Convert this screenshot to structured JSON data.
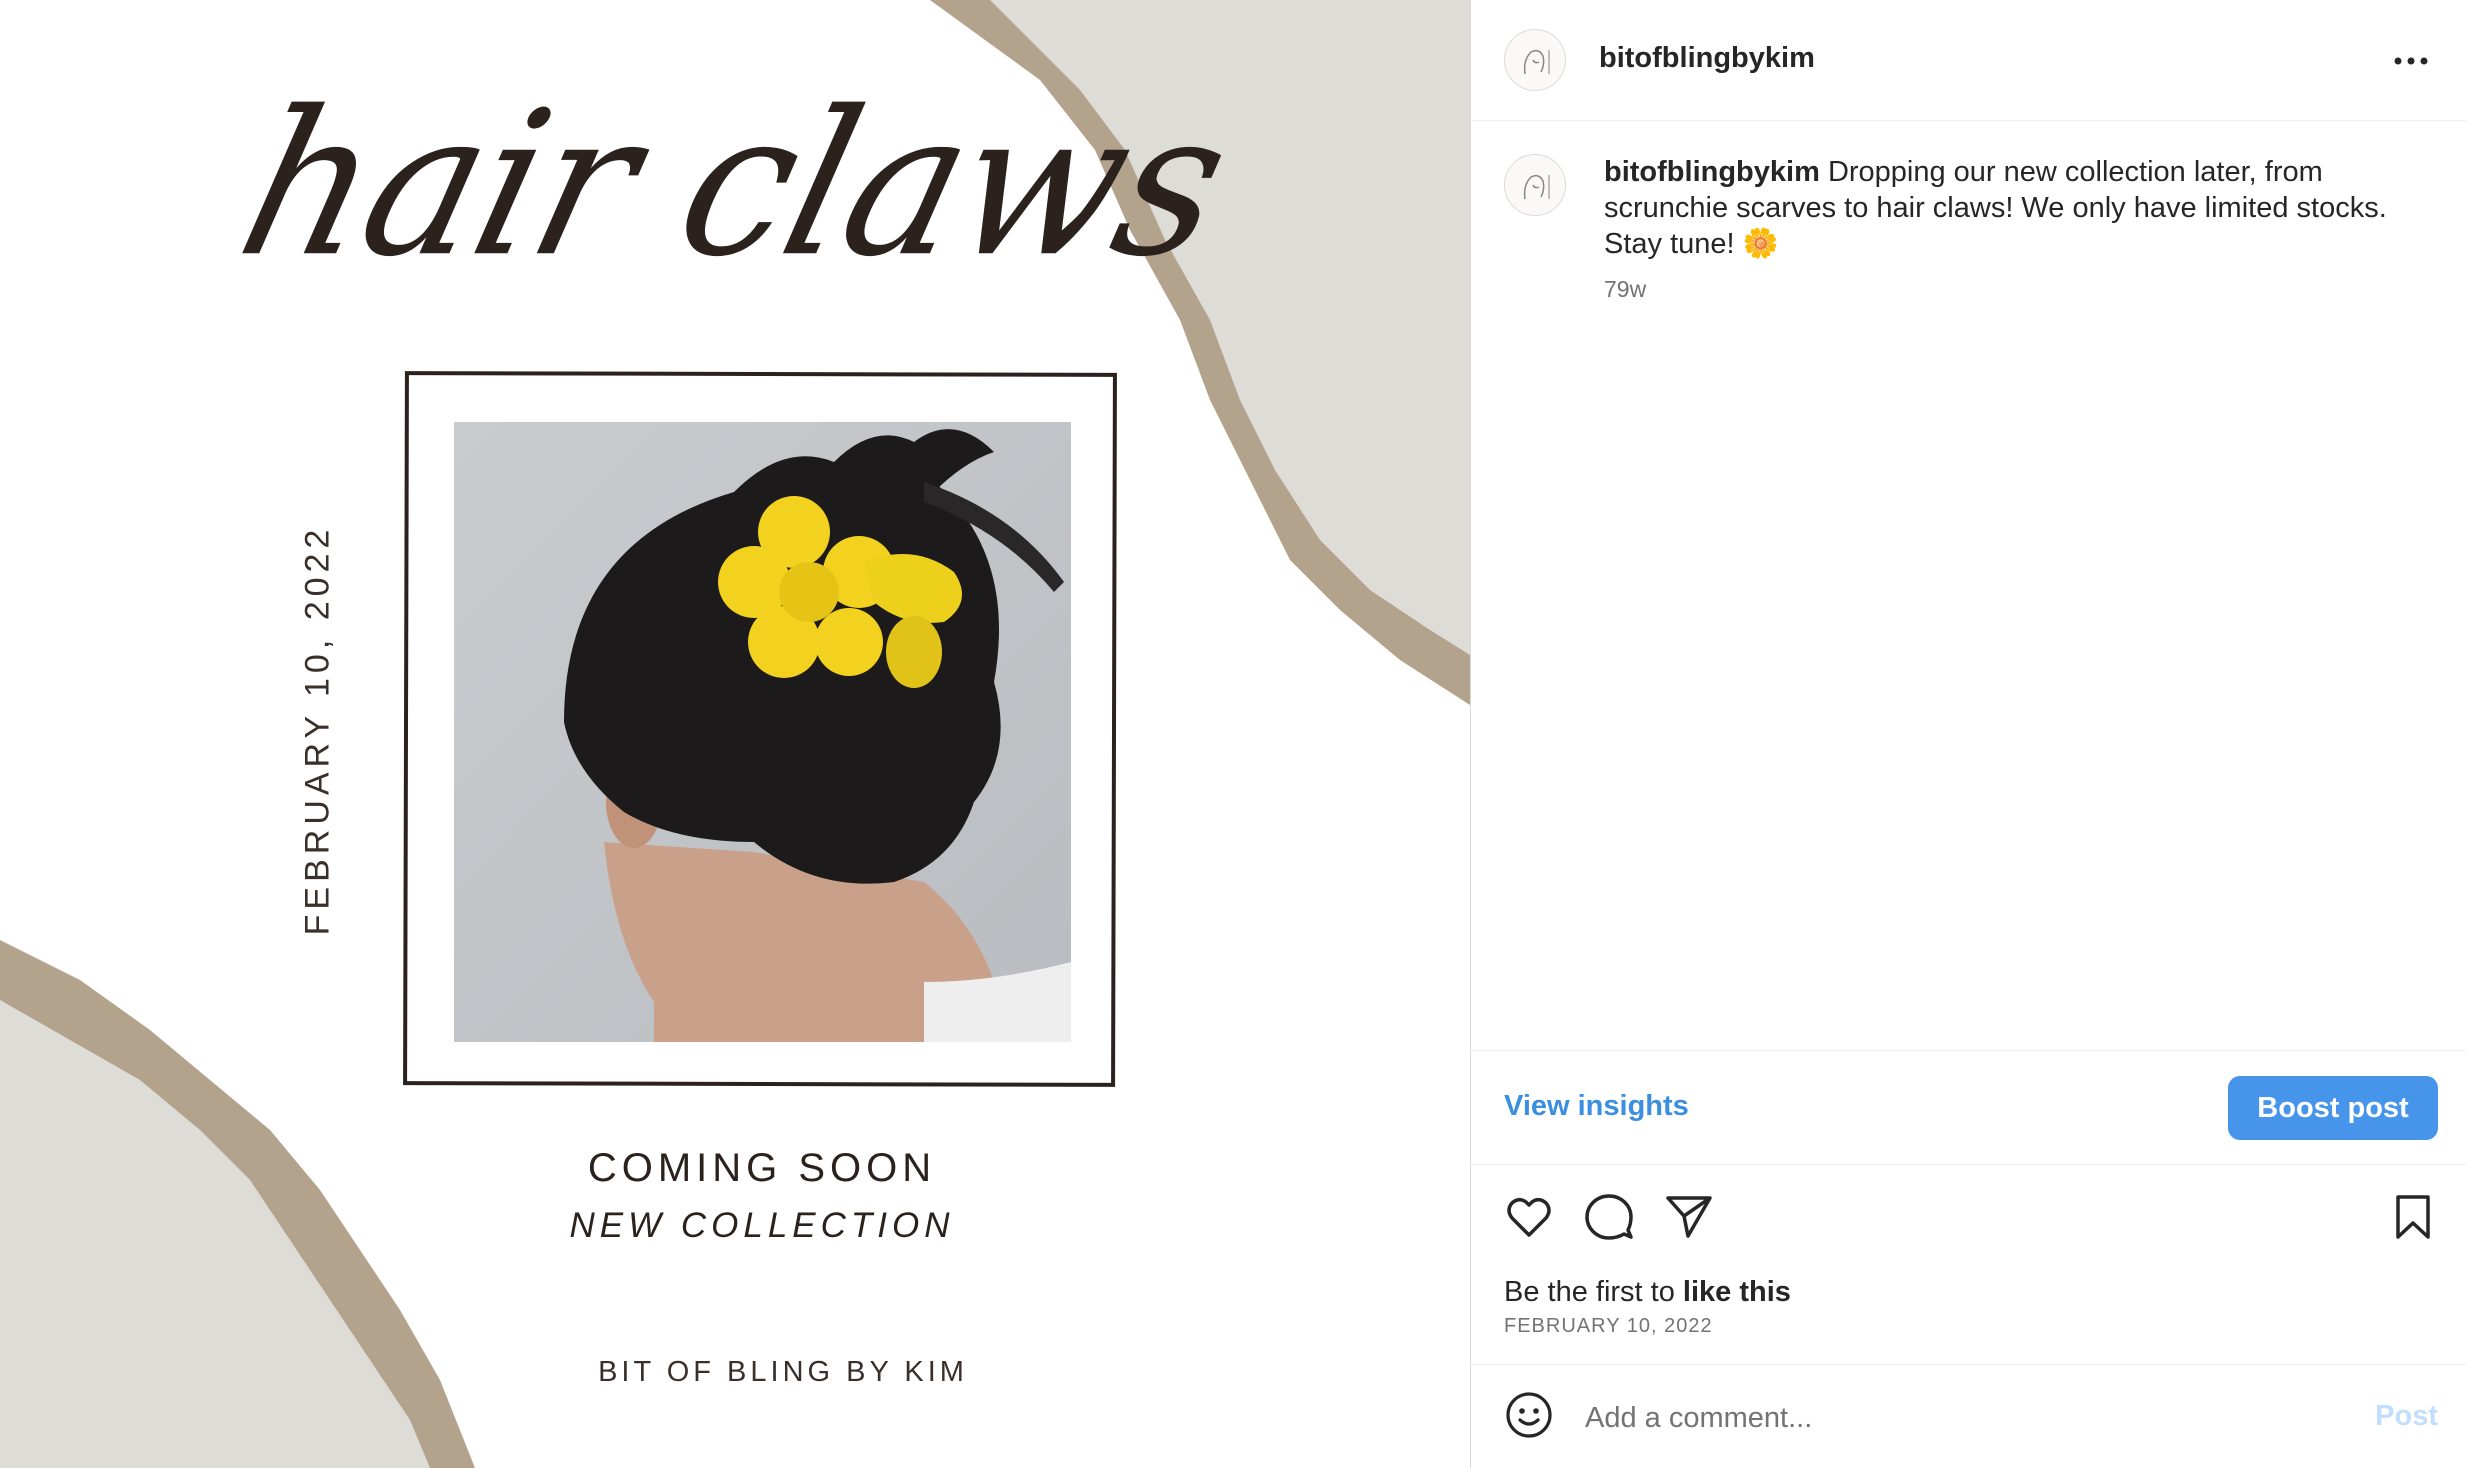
{
  "post_image": {
    "script_title": "hair claws",
    "date_vertical": "FEBRUARY 10, 2022",
    "coming_soon": "COMING SOON",
    "new_collection": "NEW COLLECTION",
    "brand_line": "BIT OF BLING BY KIM"
  },
  "header": {
    "username": "bitofblingbykim",
    "more_icon": "more-horizontal-icon"
  },
  "caption": {
    "username": "bitofblingbykim",
    "text": "Dropping our new collection later, from scrunchie scarves to hair claws! We only have limited stocks. Stay tune! 🌼",
    "age": "79w"
  },
  "insights": {
    "view_insights_label": "View insights",
    "boost_label": "Boost post"
  },
  "actions": {
    "icons": [
      "heart-icon",
      "comment-icon",
      "share-icon",
      "bookmark-icon"
    ]
  },
  "likes": {
    "prefix": "Be the first to ",
    "bold": "like this"
  },
  "post_date": "FEBRUARY 10, 2022",
  "comment": {
    "placeholder": "Add a comment...",
    "post_label": "Post"
  },
  "colors": {
    "accent_blue": "#4695ea",
    "link_blue": "#3b8fe0",
    "torn_paper": "#b3a38c",
    "paper_grey": "#dedcd7"
  }
}
